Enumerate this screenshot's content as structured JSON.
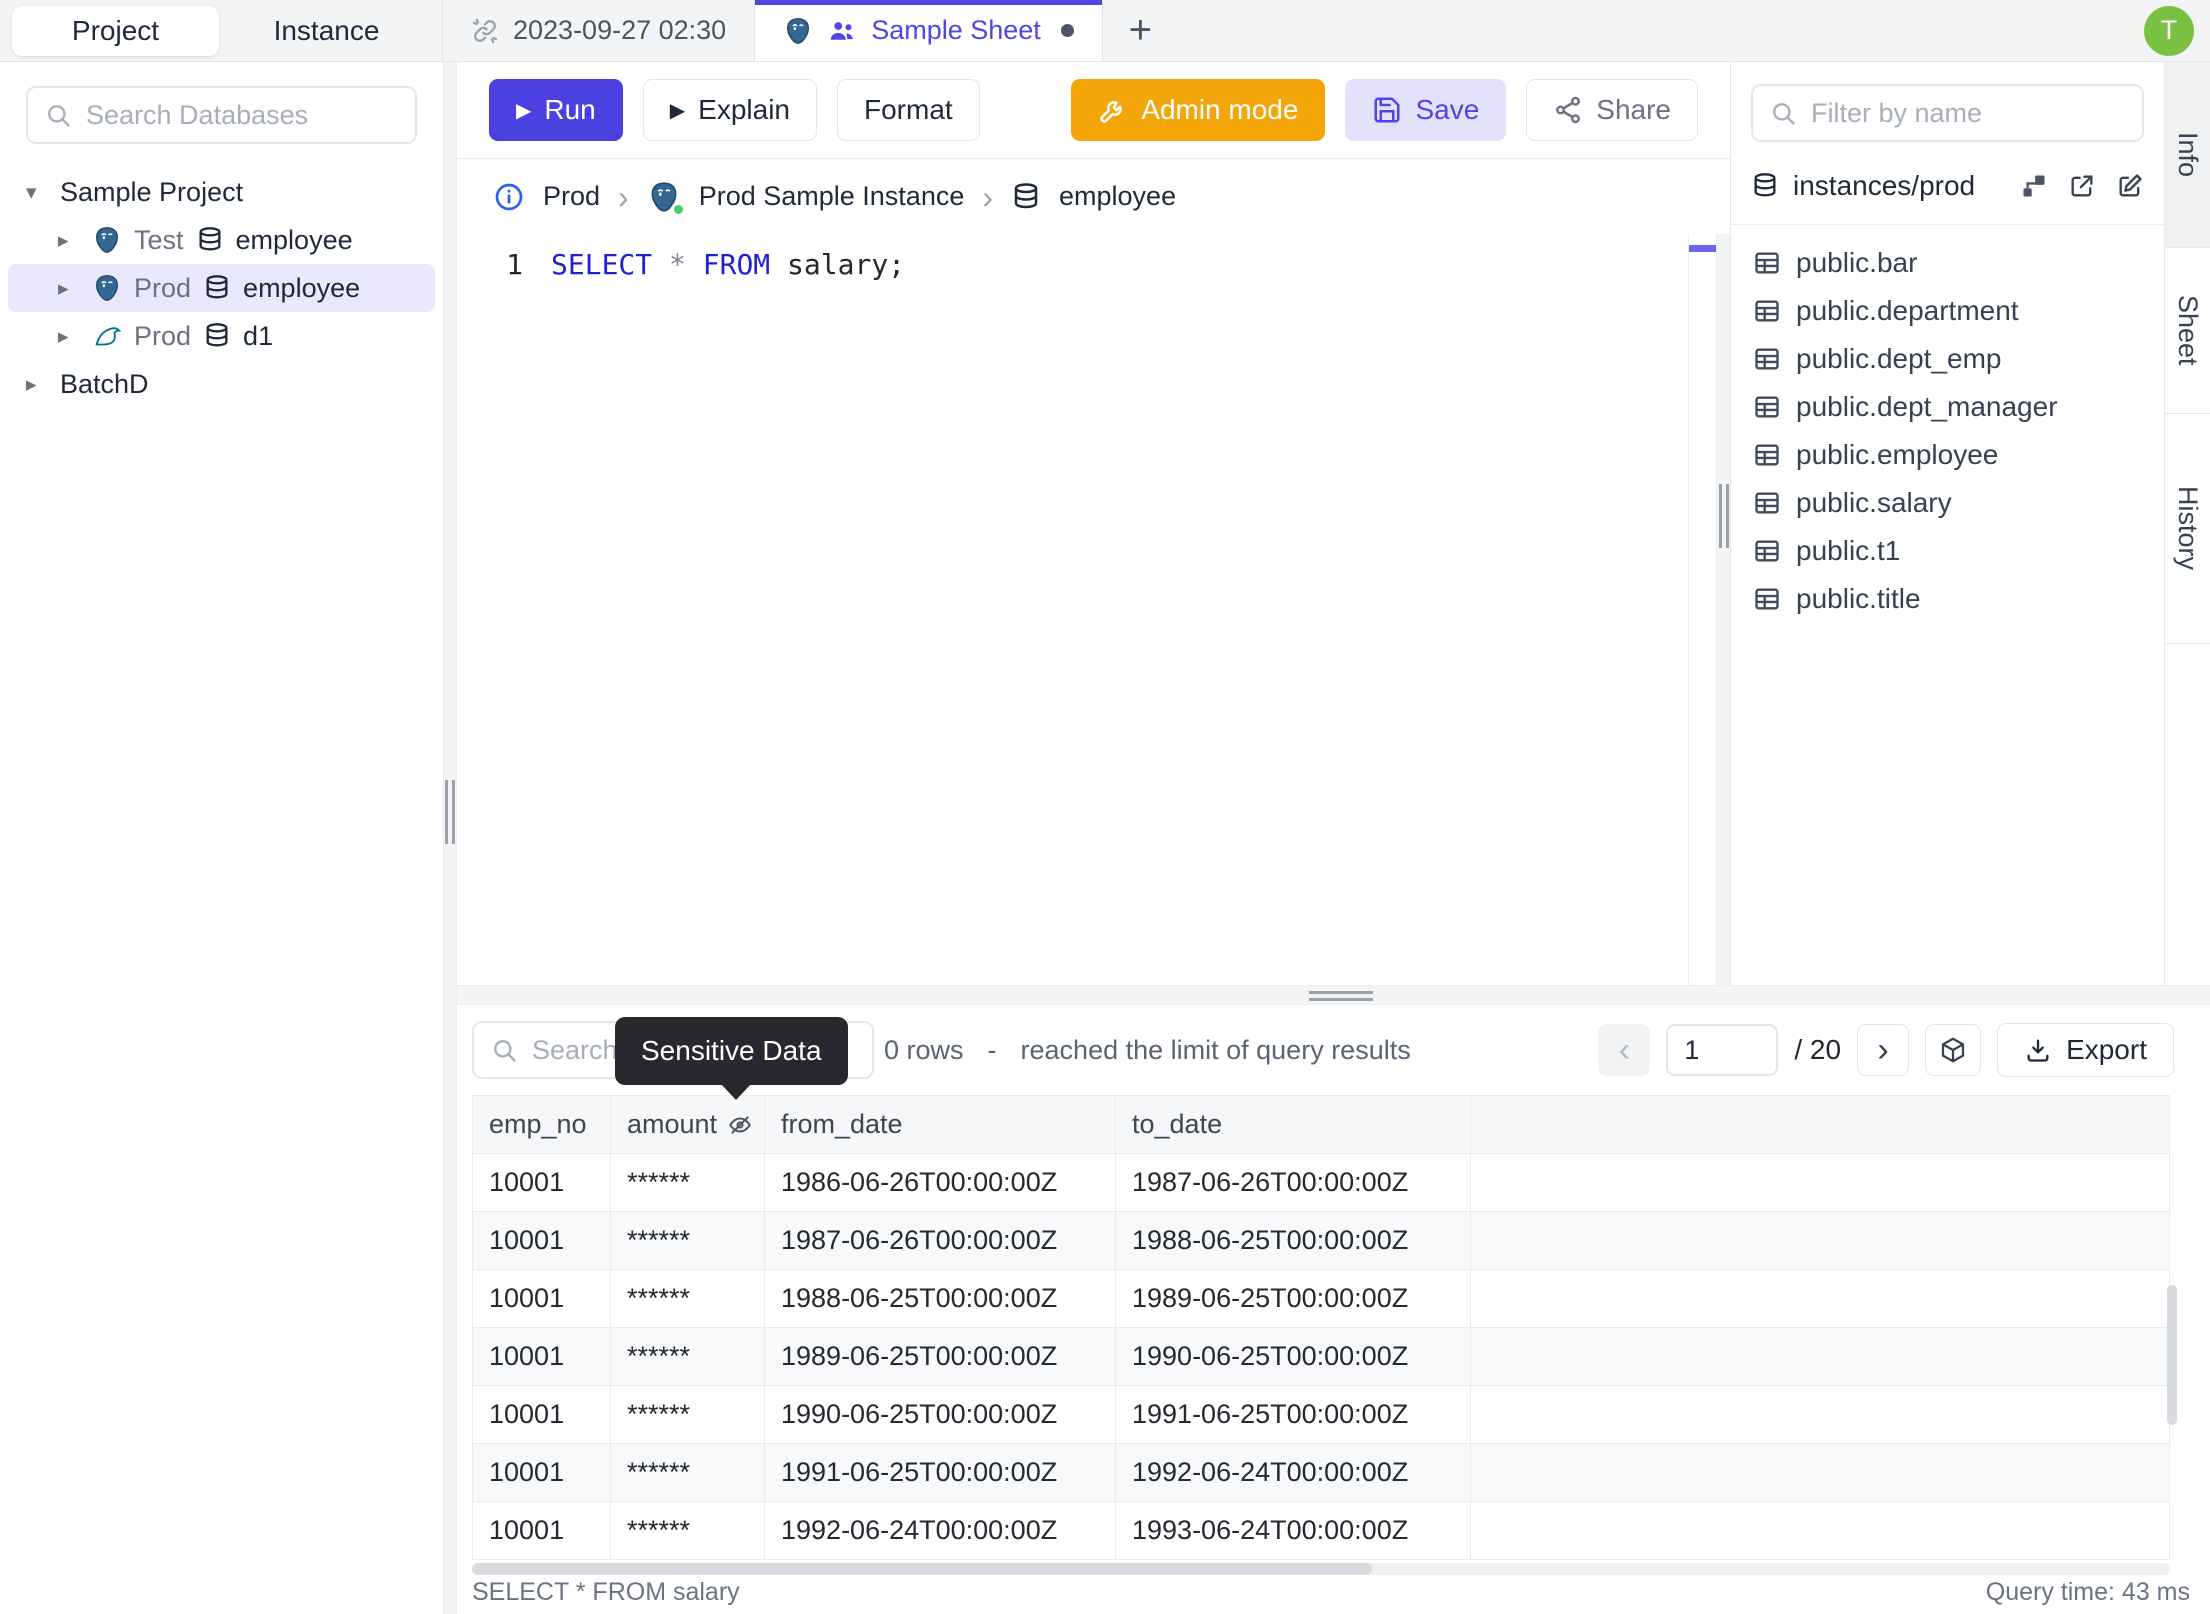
{
  "icons": {
    "plus": "+",
    "caret_down": "▾",
    "caret_right": "▸",
    "chevron": "›",
    "play": "▶",
    "prev": "‹",
    "next": "›"
  },
  "header": {
    "sidebar_tabs": [
      {
        "label": "Project"
      },
      {
        "label": "Instance"
      }
    ],
    "sheet_tabs": [
      {
        "label": "2023-09-27 02:30"
      },
      {
        "label": "Sample Sheet"
      }
    ],
    "avatar": "T"
  },
  "sidebar": {
    "search_placeholder": "Search Databases",
    "tree": {
      "root": "Sample Project",
      "items": [
        {
          "env": "Test",
          "db": "employee",
          "engine": "postgresql"
        },
        {
          "env": "Prod",
          "db": "employee",
          "engine": "postgresql"
        },
        {
          "env": "Prod",
          "db": "d1",
          "engine": "mysql"
        }
      ],
      "batch": "BatchD"
    }
  },
  "toolbar": {
    "run": "Run",
    "explain": "Explain",
    "format": "Format",
    "admin_mode": "Admin mode",
    "save": "Save",
    "share": "Share"
  },
  "breadcrumb": {
    "env": "Prod",
    "instance": "Prod Sample Instance",
    "database": "employee"
  },
  "editor": {
    "line_number": "1",
    "tokens": [
      {
        "text": "SELECT"
      },
      {
        "text": "*"
      },
      {
        "text": "FROM"
      },
      {
        "text": "salary;"
      }
    ]
  },
  "schema_panel": {
    "filter_placeholder": "Filter by name",
    "scope": "instances/prod",
    "tables": [
      "public.bar",
      "public.department",
      "public.dept_emp",
      "public.dept_manager",
      "public.employee",
      "public.salary",
      "public.t1",
      "public.title"
    ]
  },
  "side_tabs": [
    {
      "label": "Info"
    },
    {
      "label": "Sheet"
    },
    {
      "label": "History"
    }
  ],
  "results": {
    "search_placeholder": "Search",
    "tooltip": "Sensitive Data",
    "rows_count": "0 rows",
    "separator": "-",
    "limit_note": "reached the limit of query results",
    "page": "1",
    "page_total": "/ 20",
    "export_label": "Export",
    "columns": [
      "emp_no",
      "amount",
      "from_date",
      "to_date"
    ],
    "rows": [
      [
        "10001",
        "******",
        "1986-06-26T00:00:00Z",
        "1987-06-26T00:00:00Z"
      ],
      [
        "10001",
        "******",
        "1987-06-26T00:00:00Z",
        "1988-06-25T00:00:00Z"
      ],
      [
        "10001",
        "******",
        "1988-06-25T00:00:00Z",
        "1989-06-25T00:00:00Z"
      ],
      [
        "10001",
        "******",
        "1989-06-25T00:00:00Z",
        "1990-06-25T00:00:00Z"
      ],
      [
        "10001",
        "******",
        "1990-06-25T00:00:00Z",
        "1991-06-25T00:00:00Z"
      ],
      [
        "10001",
        "******",
        "1991-06-25T00:00:00Z",
        "1992-06-24T00:00:00Z"
      ],
      [
        "10001",
        "******",
        "1992-06-24T00:00:00Z",
        "1993-06-24T00:00:00Z"
      ]
    ],
    "query": "SELECT * FROM salary",
    "query_time": "Query time: 43 ms"
  },
  "colors": {
    "accent": "#4f46e5",
    "run_purple": "#4b41e0",
    "admin_orange": "#f2a60a",
    "avatar_green": "#7ac143",
    "selected_row": "#e9e8fc",
    "keyword_blue": "#1f1fd6"
  }
}
